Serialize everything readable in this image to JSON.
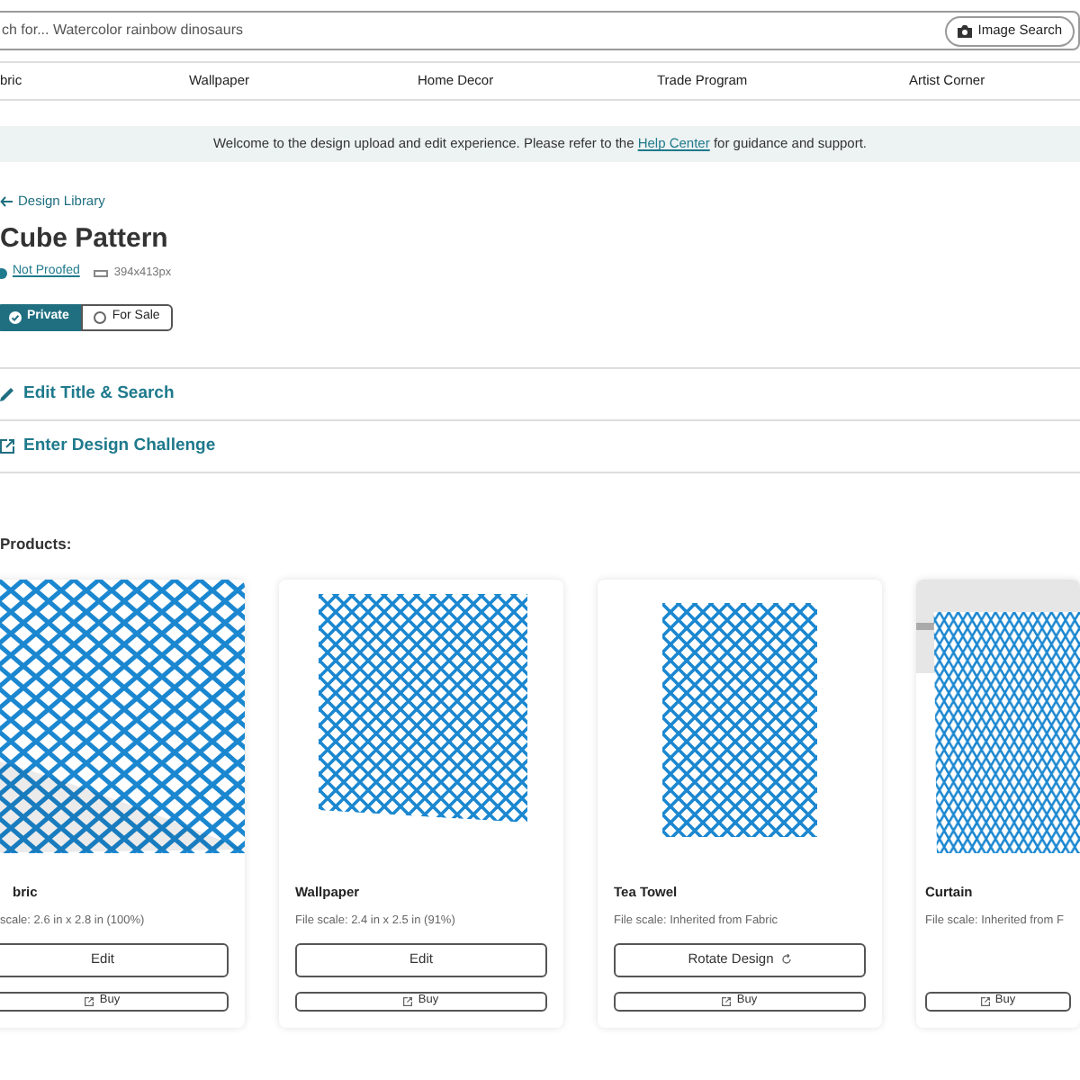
{
  "search": {
    "placeholder": "ch for... Watercolor rainbow dinosaurs",
    "button": "Image Search"
  },
  "nav": [
    "bric",
    "Wallpaper",
    "Home Decor",
    "Trade Program",
    "Artist Corner"
  ],
  "banner": {
    "before": "Welcome to the design upload and edit experience. Please refer to the",
    "link": "Help Center",
    "after": "for guidance and support."
  },
  "design": {
    "back_link": "Design Library",
    "title": "Cube Pattern",
    "proof_status": "Not Proofed",
    "dimensions": "394x413px",
    "visibility": [
      {
        "label": "Private",
        "selected": true
      },
      {
        "label": "For Sale",
        "selected": false
      }
    ],
    "actions": [
      {
        "kind": "edit",
        "label": "Edit Title & Search"
      },
      {
        "kind": "external",
        "label": "Enter Design Challenge"
      }
    ]
  },
  "products_heading": "Products:",
  "products": [
    {
      "kind": "fabric",
      "name": "bric",
      "file_scale": "scale: 2.6 in x 2.8 in (100%)",
      "action": {
        "kind": "edit",
        "label": "Edit"
      },
      "buy": "Buy"
    },
    {
      "kind": "wallpaper",
      "name": "Wallpaper",
      "file_scale": "File scale: 2.4 in x 2.5 in (91%)",
      "action": {
        "kind": "edit",
        "label": "Edit"
      },
      "buy": "Buy"
    },
    {
      "kind": "towel",
      "name": "Tea Towel",
      "file_scale": "File scale: Inherited from Fabric",
      "action": {
        "kind": "rotate",
        "label": "Rotate Design"
      },
      "buy": "Buy"
    },
    {
      "kind": "curtain",
      "name": "Curtain",
      "file_scale": "File scale: Inherited from F",
      "buy": "Buy"
    }
  ]
}
